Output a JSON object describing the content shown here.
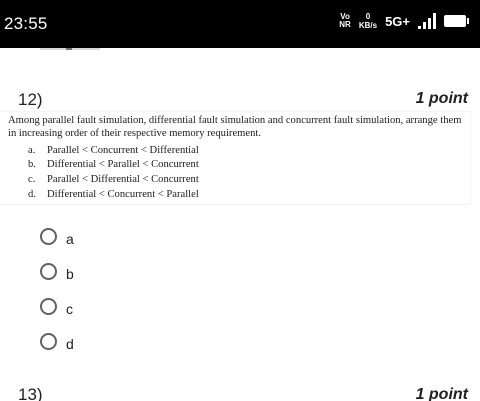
{
  "status_bar": {
    "time": "23:55",
    "volte_top": "Vo",
    "volte_bottom": "NR",
    "speed_value": "0",
    "speed_unit": "KB/s",
    "network": "5G+",
    "signal_icon": "signal-bars-icon",
    "battery_icon": "battery-icon"
  },
  "question": {
    "number": "12)",
    "points": "1 point",
    "text": "Among parallel fault simulation, differential fault simulation and concurrent fault simulation, arrange them in increasing order of their respective memory requirement.",
    "options": [
      {
        "letter": "a.",
        "text": "Parallel < Concurrent < Differential"
      },
      {
        "letter": "b.",
        "text": "Differential < Parallel < Concurrent"
      },
      {
        "letter": "c.",
        "text": "Parallel < Differential < Concurrent"
      },
      {
        "letter": "d.",
        "text": "Differential < Concurrent < Parallel"
      }
    ]
  },
  "choices": [
    {
      "label": "a"
    },
    {
      "label": "b"
    },
    {
      "label": "c"
    },
    {
      "label": "d"
    }
  ],
  "next_question": {
    "number": "13)",
    "points": "1 point"
  }
}
